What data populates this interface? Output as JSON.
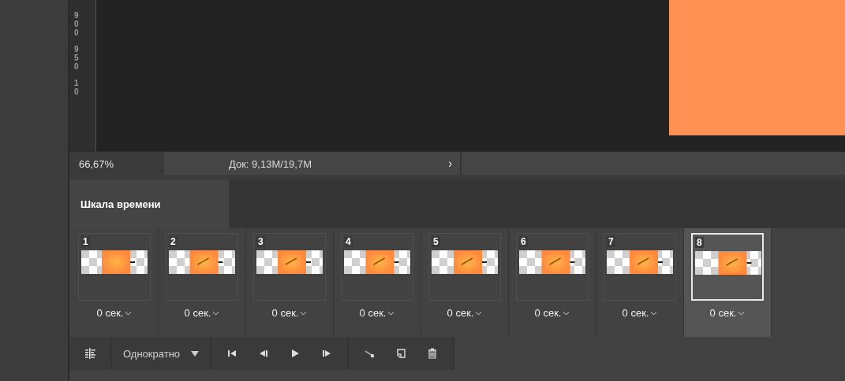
{
  "ruler": {
    "labels": [
      "900",
      "950",
      "10"
    ]
  },
  "status_bar": {
    "zoom": "66,67%",
    "doc": "Док: 9,13M/19,7M",
    "arrow": "›"
  },
  "panel": {
    "tabs": [
      {
        "label": "Шкала времени",
        "selected": true
      }
    ]
  },
  "frames": [
    {
      "number": "1",
      "delay": "0 сек.",
      "selected": false
    },
    {
      "number": "2",
      "delay": "0 сек.",
      "selected": false
    },
    {
      "number": "3",
      "delay": "0 сек.",
      "selected": false
    },
    {
      "number": "4",
      "delay": "0 сек.",
      "selected": false
    },
    {
      "number": "5",
      "delay": "0 сек.",
      "selected": false
    },
    {
      "number": "6",
      "delay": "0 сек.",
      "selected": false
    },
    {
      "number": "7",
      "delay": "0 сек.",
      "selected": false
    },
    {
      "number": "8",
      "delay": "0 сек.",
      "selected": true
    }
  ],
  "toolbar": {
    "loop": "Однократно"
  }
}
